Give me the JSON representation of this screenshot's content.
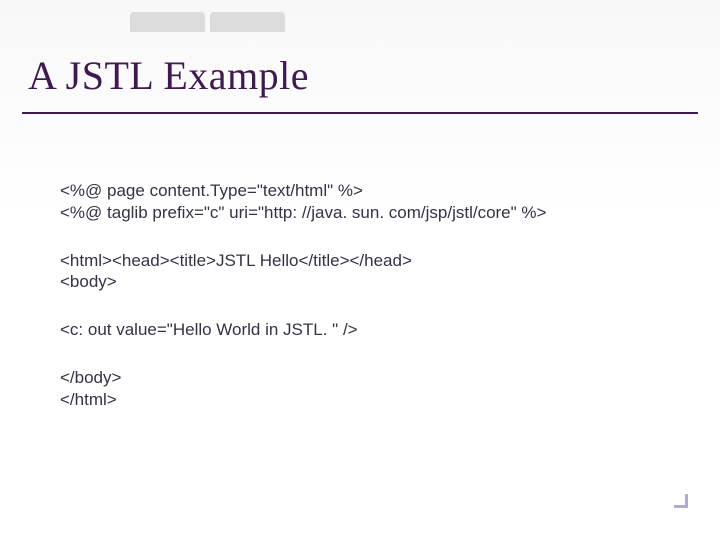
{
  "slide": {
    "title": "A JSTL Example",
    "code": {
      "block1": {
        "line1": "<%@ page content.Type=\"text/html\" %>",
        "line2": "<%@ taglib prefix=\"c\" uri=\"http: //java. sun. com/jsp/jstl/core\" %>"
      },
      "block2": {
        "line1": "<html><head><title>JSTL Hello</title></head>",
        "line2": "<body>"
      },
      "block3": {
        "line1": "<c: out value=\"Hello World in JSTL. \" />"
      },
      "block4": {
        "line1": "</body>",
        "line2": "</html>"
      }
    }
  }
}
